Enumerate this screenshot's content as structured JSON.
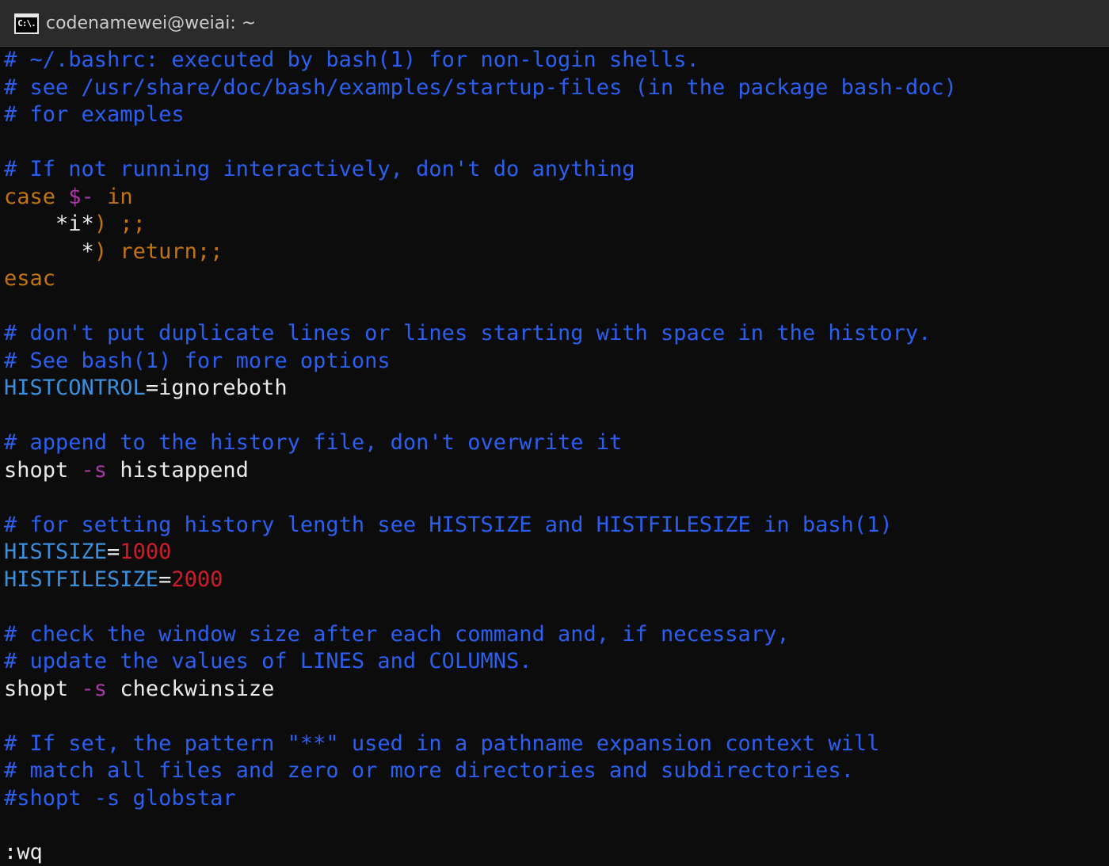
{
  "window": {
    "title": "codenamewei@weiai: ~",
    "icon_text": "C:\\."
  },
  "editor": {
    "lines": {
      "l1": "# ~/.bashrc: executed by bash(1) for non-login shells.",
      "l2": "# see /usr/share/doc/bash/examples/startup-files (in the package bash-doc)",
      "l3": "# for examples",
      "l5": "# If not running interactively, don't do anything",
      "l6_case": "case",
      "l6_var": "$-",
      "l6_in": "in",
      "l7_indent": "    ",
      "l7_pat": "*i*",
      "l7_paren": ")",
      "l7_rest": " ;;",
      "l8_indent": "      ",
      "l8_pat": "*",
      "l8_paren": ")",
      "l8_rest": " return;;",
      "l9": "esac",
      "l11": "# don't put duplicate lines or lines starting with space in the history.",
      "l12": "# See bash(1) for more options",
      "l13_var": "HISTCONTROL",
      "l13_eq": "=",
      "l13_val": "ignoreboth",
      "l15": "# append to the history file, don't overwrite it",
      "l16_cmd": "shopt",
      "l16_opt": "-s",
      "l16_arg": "histappend",
      "l18": "# for setting history length see HISTSIZE and HISTFILESIZE in bash(1)",
      "l19_var": "HISTSIZE",
      "l19_eq": "=",
      "l19_val": "1000",
      "l20_var": "HISTFILESIZE",
      "l20_eq": "=",
      "l20_val": "2000",
      "l22": "# check the window size after each command and, if necessary,",
      "l23": "# update the values of LINES and COLUMNS.",
      "l24_cmd": "shopt",
      "l24_opt": "-s",
      "l24_arg": "checkwinsize",
      "l26": "# If set, the pattern \"**\" used in a pathname expansion context will",
      "l27": "# match all files and zero or more directories and subdirectories.",
      "l28": "#shopt -s globstar"
    },
    "command_line": ":wq"
  },
  "colors": {
    "background": "#0c0c0c",
    "titlebar": "#2b2b2b",
    "comment": "#2b5ff0",
    "keyword": "#c2740f",
    "variable": "#3b8fdc",
    "special": "#a83aa8",
    "number": "#d01c2a",
    "text": "#eaeaea"
  }
}
